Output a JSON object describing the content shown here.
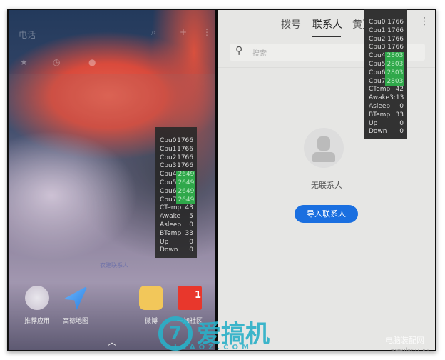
{
  "left_pane": {
    "ghost_title": "电话",
    "stats": [
      {
        "label": "Cpu0",
        "value": "1766",
        "highlight": false
      },
      {
        "label": "Cpu1",
        "value": "1766",
        "highlight": false
      },
      {
        "label": "Cpu2",
        "value": "1766",
        "highlight": false
      },
      {
        "label": "Cpu3",
        "value": "1766",
        "highlight": false
      },
      {
        "label": "Cpu4",
        "value": "2649",
        "highlight": true
      },
      {
        "label": "Cpu5",
        "value": "2649",
        "highlight": true
      },
      {
        "label": "Cpu6",
        "value": "2649",
        "highlight": true
      },
      {
        "label": "Cpu7",
        "value": "2649",
        "highlight": true
      },
      {
        "label": "CTemp",
        "value": "43",
        "highlight": false
      },
      {
        "label": "Awake",
        "value": "5",
        "highlight": false
      },
      {
        "label": "Asleep",
        "value": "0",
        "highlight": false
      },
      {
        "label": "BTemp",
        "value": "33",
        "highlight": false
      },
      {
        "label": "Up",
        "value": "0",
        "highlight": false
      },
      {
        "label": "Down",
        "value": "0",
        "highlight": false
      }
    ],
    "ghost_link": "农建联系人",
    "dock": [
      {
        "label": "推荐应用",
        "icon": "folder-icon"
      },
      {
        "label": "高德地图",
        "icon": "amap-icon"
      },
      {
        "label": "微博",
        "icon": "weibo-icon"
      },
      {
        "label": "一加社区",
        "icon": "oneplus-community-icon",
        "badge": "1"
      }
    ]
  },
  "right_pane": {
    "tabs": [
      {
        "label": "拨号"
      },
      {
        "label": "联系人",
        "active": true
      },
      {
        "label": "黄页"
      }
    ],
    "search_placeholder": "搜索",
    "empty_text": "无联系人",
    "import_button": "导入联系人",
    "stats": [
      {
        "label": "Cpu0",
        "value": "1766",
        "highlight": false
      },
      {
        "label": "Cpu1",
        "value": "1766",
        "highlight": false
      },
      {
        "label": "Cpu2",
        "value": "1766",
        "highlight": false
      },
      {
        "label": "Cpu3",
        "value": "1766",
        "highlight": false
      },
      {
        "label": "Cpu4",
        "value": "2803",
        "highlight": true
      },
      {
        "label": "Cpu5",
        "value": "2803",
        "highlight": true
      },
      {
        "label": "Cpu6",
        "value": "2803",
        "highlight": true
      },
      {
        "label": "Cpu7",
        "value": "2803",
        "highlight": true
      },
      {
        "label": "CTemp",
        "value": "42",
        "highlight": false
      },
      {
        "label": "Awake",
        "value": "3:13",
        "highlight": false
      },
      {
        "label": "Asleep",
        "value": "0",
        "highlight": false
      },
      {
        "label": "BTemp",
        "value": "33",
        "highlight": false
      },
      {
        "label": "Up",
        "value": "0",
        "highlight": false
      },
      {
        "label": "Down",
        "value": "0",
        "highlight": false
      }
    ]
  },
  "watermarks": {
    "brand": "爱搞机",
    "brand_url": "IGAOZ.COM",
    "site": "电脑装配网",
    "site_url": "www.dnzp.com"
  },
  "colors": {
    "accent": "#1a6fe0",
    "highlight": "#2fa84a"
  }
}
